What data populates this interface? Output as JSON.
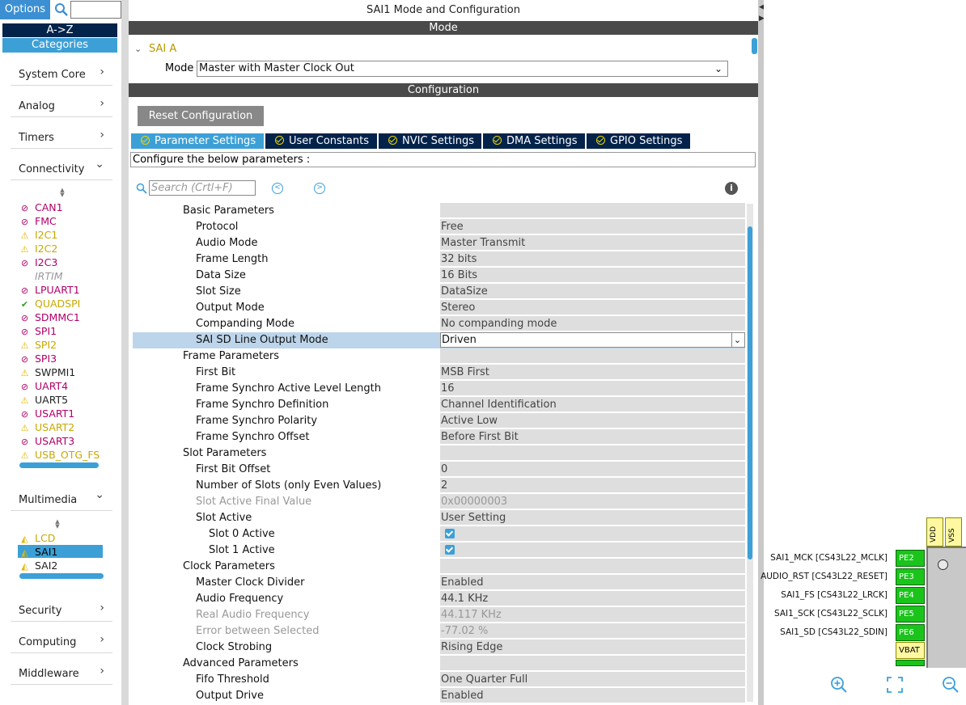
{
  "sidebar": {
    "options_label": "Options",
    "sort_label": "A->Z",
    "categories_label": "Categories",
    "categories": [
      {
        "label": "System Core",
        "chev": "›"
      },
      {
        "label": "Analog",
        "chev": "›"
      },
      {
        "label": "Timers",
        "chev": "›"
      },
      {
        "label": "Connectivity",
        "chev": "⌄"
      }
    ],
    "connectivity_items": [
      {
        "label": "CAN1",
        "status": "disabled"
      },
      {
        "label": "FMC",
        "status": "disabled"
      },
      {
        "label": "I2C1",
        "status": "warning"
      },
      {
        "label": "I2C2",
        "status": "warning"
      },
      {
        "label": "I2C3",
        "status": "disabled"
      },
      {
        "label": "IRTIM",
        "status": "unavailable"
      },
      {
        "label": "LPUART1",
        "status": "disabled"
      },
      {
        "label": "QUADSPI",
        "status": "ok"
      },
      {
        "label": "SDMMC1",
        "status": "disabled"
      },
      {
        "label": "SPI1",
        "status": "disabled"
      },
      {
        "label": "SPI2",
        "status": "warning"
      },
      {
        "label": "SPI3",
        "status": "disabled"
      },
      {
        "label": "SWPMI1",
        "status": "warning-plain"
      },
      {
        "label": "UART4",
        "status": "disabled"
      },
      {
        "label": "UART5",
        "status": "warning-plain"
      },
      {
        "label": "USART1",
        "status": "disabled"
      },
      {
        "label": "USART2",
        "status": "warning"
      },
      {
        "label": "USART3",
        "status": "disabled"
      },
      {
        "label": "USB_OTG_FS",
        "status": "warning"
      }
    ],
    "multimedia_label": "Multimedia",
    "multimedia_items": [
      {
        "label": "LCD",
        "status": "partial"
      },
      {
        "label": "SAI1",
        "status": "partial",
        "selected": true
      },
      {
        "label": "SAI2",
        "status": "partial"
      }
    ],
    "bottom_categories": [
      {
        "label": "Security"
      },
      {
        "label": "Computing"
      },
      {
        "label": "Middleware"
      }
    ]
  },
  "main": {
    "title": "SAI1 Mode and Configuration",
    "mode_header": "Mode",
    "sai_block": "SAI A",
    "mode_label": "Mode",
    "mode_value": "Master with Master Clock Out",
    "config_header": "Configuration",
    "reset_button": "Reset Configuration",
    "tabs": [
      {
        "label": "Parameter Settings",
        "active": true
      },
      {
        "label": "User Constants"
      },
      {
        "label": "NVIC Settings"
      },
      {
        "label": "DMA Settings"
      },
      {
        "label": "GPIO Settings"
      }
    ],
    "config_hint": "Configure the below parameters :",
    "search_placeholder": "Search (Crtl+F)",
    "params": [
      {
        "k": "Basic Parameters",
        "v": "",
        "level": 0
      },
      {
        "k": "Protocol",
        "v": "Free",
        "level": 1
      },
      {
        "k": "Audio Mode",
        "v": "Master Transmit",
        "level": 1
      },
      {
        "k": "Frame Length",
        "v": "32 bits",
        "level": 1
      },
      {
        "k": "Data Size",
        "v": "16 Bits",
        "level": 1
      },
      {
        "k": "Slot Size",
        "v": "DataSize",
        "level": 1
      },
      {
        "k": "Output Mode",
        "v": "Stereo",
        "level": 1
      },
      {
        "k": "Companding Mode",
        "v": "No companding mode",
        "level": 1
      },
      {
        "k": "SAI SD Line Output Mode",
        "v": "Driven",
        "level": 1,
        "selected": true
      },
      {
        "k": "Frame Parameters",
        "v": "",
        "level": 0
      },
      {
        "k": "First Bit",
        "v": "MSB First",
        "level": 1
      },
      {
        "k": "Frame Synchro Active Level Length",
        "v": "16",
        "level": 1
      },
      {
        "k": "Frame Synchro Definition",
        "v": "Channel Identification",
        "level": 1
      },
      {
        "k": "Frame Synchro Polarity",
        "v": "Active Low",
        "level": 1
      },
      {
        "k": "Frame Synchro Offset",
        "v": "Before First Bit",
        "level": 1
      },
      {
        "k": "Slot Parameters",
        "v": "",
        "level": 0
      },
      {
        "k": "First Bit Offset",
        "v": "0",
        "level": 1
      },
      {
        "k": "Number of Slots (only Even Values)",
        "v": "2",
        "level": 1
      },
      {
        "k": "Slot Active Final Value",
        "v": "0x00000003",
        "level": 1,
        "disabled": true
      },
      {
        "k": "Slot Active",
        "v": "User Setting",
        "level": 1
      },
      {
        "k": "Slot 0 Active",
        "v": "",
        "level": 2,
        "checkbox": true
      },
      {
        "k": "Slot 1 Active",
        "v": "",
        "level": 2,
        "checkbox": true
      },
      {
        "k": "Clock Parameters",
        "v": "",
        "level": 0
      },
      {
        "k": "Master Clock Divider",
        "v": "Enabled",
        "level": 1
      },
      {
        "k": "Audio Frequency",
        "v": "44.1 KHz",
        "level": 1
      },
      {
        "k": "Real Audio Frequency",
        "v": "44.117 KHz",
        "level": 1,
        "disabled": true
      },
      {
        "k": "Error between Selected",
        "v": "-77.02 %",
        "level": 1,
        "disabled": true
      },
      {
        "k": "Clock Strobing",
        "v": "Rising Edge",
        "level": 1
      },
      {
        "k": "Advanced Parameters",
        "v": "",
        "level": 0
      },
      {
        "k": "Fifo Threshold",
        "v": "One Quarter Full",
        "level": 1
      },
      {
        "k": "Output Drive",
        "v": "Enabled",
        "level": 1
      }
    ]
  },
  "pinout": {
    "top_pins": [
      "VDD",
      "VSS"
    ],
    "pins": [
      {
        "label": "SAI1_MCK [CS43L22_MCLK]",
        "pin": "PE2"
      },
      {
        "label": "AUDIO_RST [CS43L22_RESET]",
        "pin": "PE3"
      },
      {
        "label": "SAI1_FS [CS43L22_LRCK]",
        "pin": "PE4"
      },
      {
        "label": "SAI1_SCK [CS43L22_SCLK]",
        "pin": "PE5"
      },
      {
        "label": "SAI1_SD [CS43L22_SDIN]",
        "pin": "PE6"
      }
    ],
    "vbat": "VBAT"
  },
  "colors": {
    "accent": "#3ca0d7",
    "navy": "#03234b",
    "pin_green": "#1bc41b",
    "disabled_magenta": "#b0006a",
    "warning_yellow": "#c8a800"
  }
}
